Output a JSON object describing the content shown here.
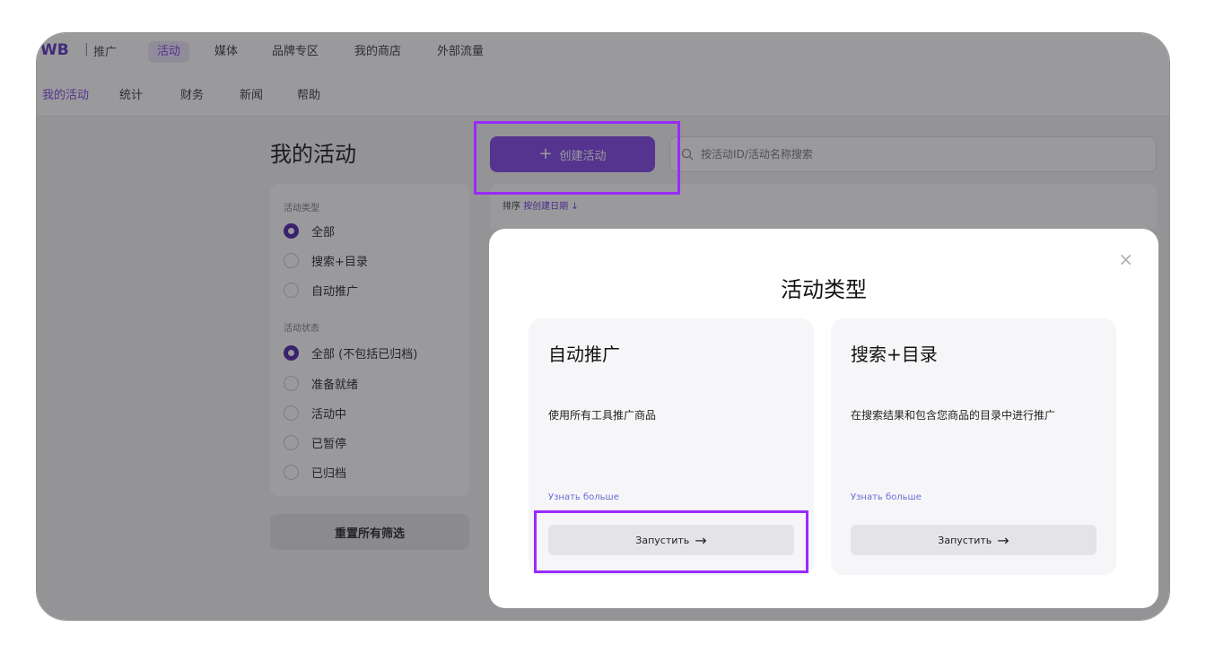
{
  "topnav": {
    "logo": "WB",
    "logo_sub": "推广",
    "tabs": [
      "活动",
      "媒体",
      "品牌专区",
      "我的商店",
      "外部流量"
    ]
  },
  "subnav": {
    "items": [
      "我的活动",
      "统计",
      "财务",
      "新闻",
      "帮助"
    ]
  },
  "main": {
    "title": "我的活动",
    "create_label": "创建活动",
    "search_placeholder": "按活动ID/活动名称搜索",
    "sort_label": "排序",
    "sort_value": "按创建日期 ↓"
  },
  "filters": {
    "type_title": "活动类型",
    "types": [
      "全部",
      "搜索+目录",
      "自动推广"
    ],
    "status_title": "活动状态",
    "statuses": [
      "全部 (不包括已归档)",
      "准备就绪",
      "活动中",
      "已暂停",
      "已归档"
    ],
    "reset_label": "重置所有筛选"
  },
  "modal": {
    "title": "活动类型",
    "close": "×",
    "cards": [
      {
        "title": "自动推广",
        "desc": "使用所有工具推广商品",
        "more": "Узнать больше",
        "launch": "Запустить"
      },
      {
        "title": "搜索+目录",
        "desc": "在搜索结果和包含您商品的目录中进行推广",
        "more": "Узнать больше",
        "launch": "Запустить"
      }
    ]
  },
  "colors": {
    "accent": "#7b3fe4",
    "highlight": "#9a2bff",
    "overlay": "rgba(40,40,45,0.47)"
  }
}
